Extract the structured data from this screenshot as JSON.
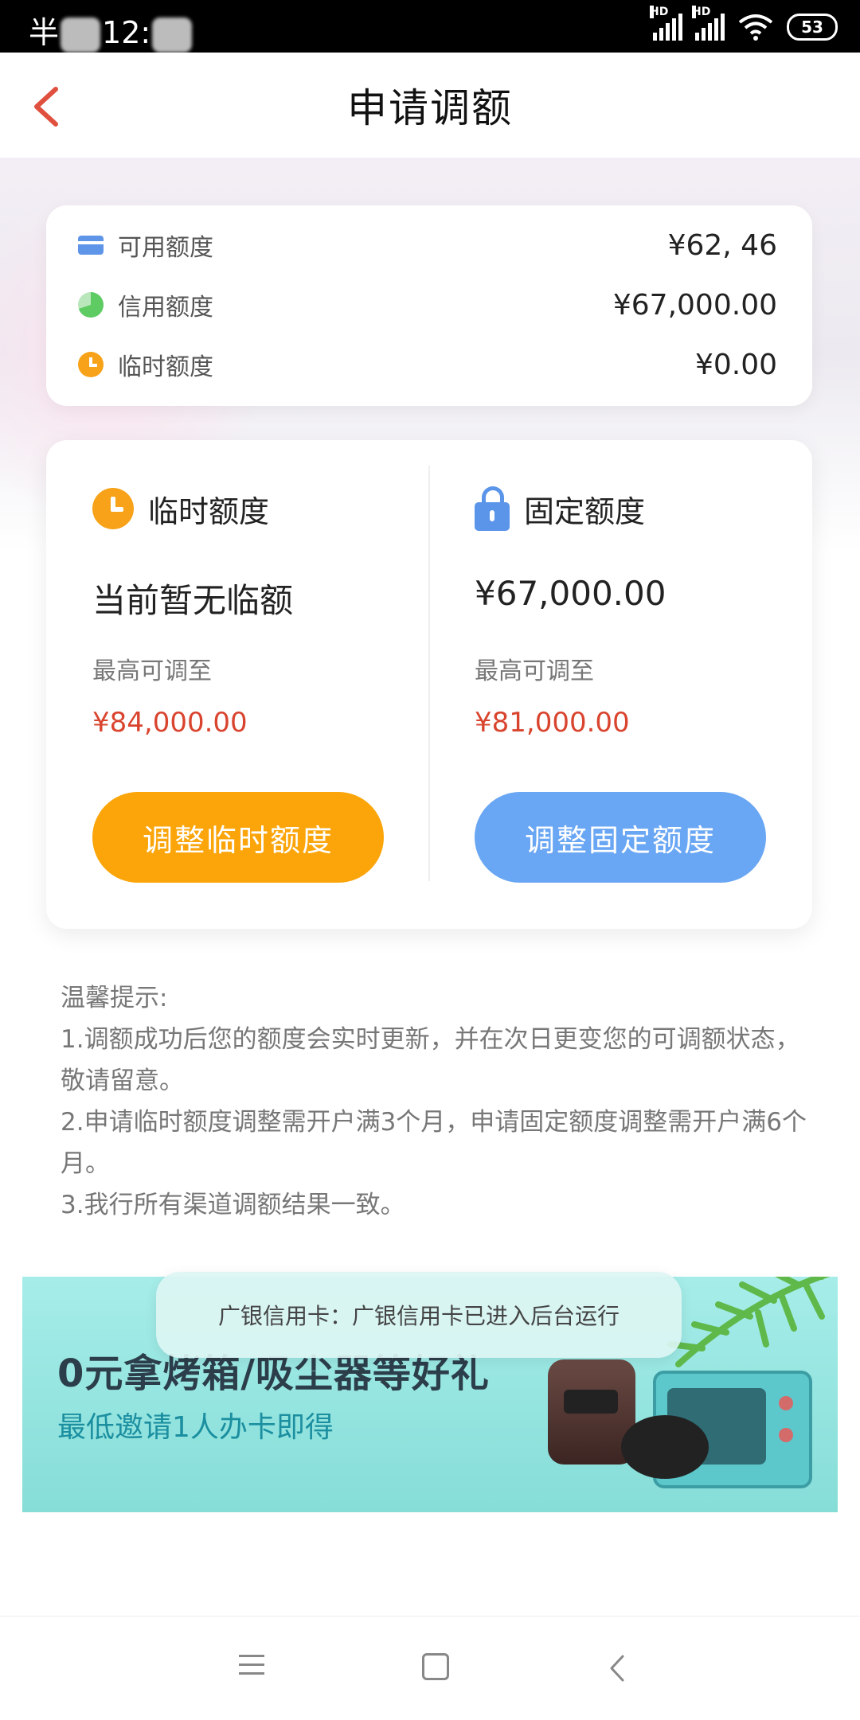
{
  "status_bar": {
    "time_prefix": "半",
    "time": "12:",
    "signal_labels": [
      "HD",
      "HD"
    ],
    "battery": "53"
  },
  "header": {
    "title": "申请调额"
  },
  "summary": {
    "rows": [
      {
        "label": "可用额度",
        "value": "¥62,        46",
        "icon": "credit-card-icon"
      },
      {
        "label": "信用额度",
        "value": "¥67,000.00",
        "icon": "pie-chart-icon"
      },
      {
        "label": "临时额度",
        "value": "¥0.00",
        "icon": "clock-icon"
      }
    ]
  },
  "adjust": {
    "temporary": {
      "title": "临时额度",
      "current": "当前暂无临额",
      "max_label": "最高可调至",
      "max_value": "¥84,000.00",
      "button": "调整临时额度"
    },
    "fixed": {
      "title": "固定额度",
      "current": "¥67,000.00",
      "max_label": "最高可调至",
      "max_value": "¥81,000.00",
      "button": "调整固定额度"
    }
  },
  "tips": {
    "title": "温馨提示:",
    "lines": [
      "1.调额成功后您的额度会实时更新，并在次日更变您的可调额状态，敬请留意。",
      "2.申请临时额度调整需开户满3个月，申请固定额度调整需开户满6个月。",
      "3.我行所有渠道调额结果一致。"
    ]
  },
  "banner": {
    "title": "0元拿烤箱/吸尘器等好礼",
    "subtitle": "最低邀请1人办卡即得"
  },
  "toast": {
    "text": "广银信用卡：广银信用卡已进入后台运行"
  },
  "colors": {
    "orange": "#fba50a",
    "blue": "#69a6f3",
    "red_value": "#d9442e",
    "back_arrow": "#e0503f"
  }
}
